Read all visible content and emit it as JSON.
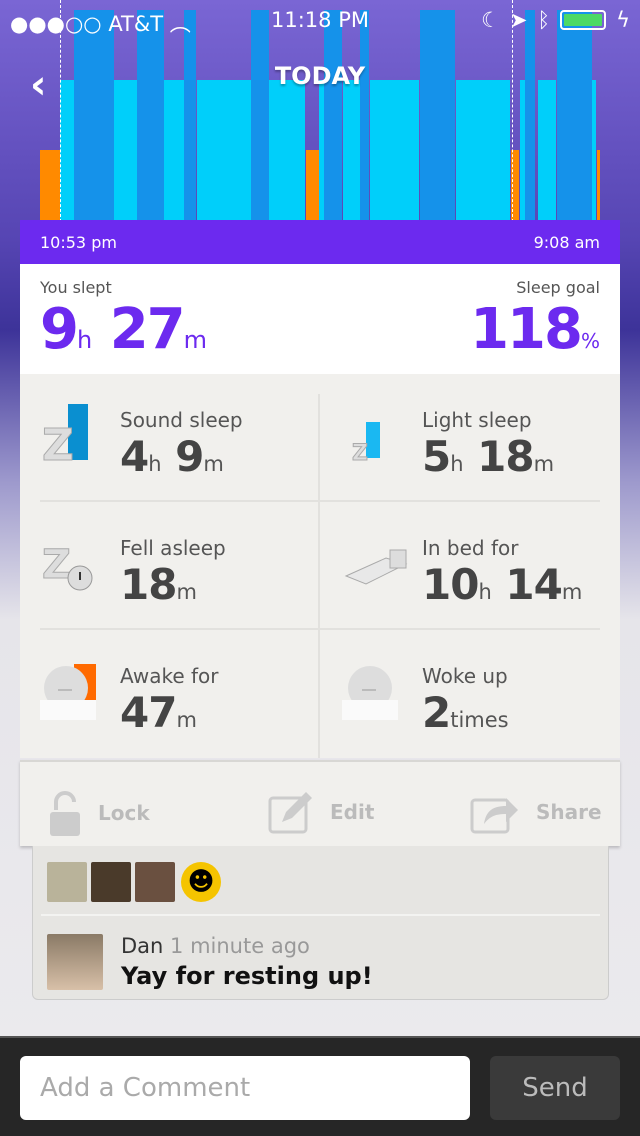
{
  "status_bar": {
    "carrier": "AT&T",
    "time": "11:18 PM",
    "signal_bars": 3,
    "signal_total": 5,
    "icons": [
      "wifi-icon",
      "moon-icon",
      "location-icon",
      "bluetooth-icon",
      "battery-icon",
      "charging-icon"
    ]
  },
  "header": {
    "title": "TODAY",
    "back_icon": "chevron-left-icon"
  },
  "timeline": {
    "start": "10:53 pm",
    "end": "9:08 am"
  },
  "colors": {
    "accent": "#6c2aef",
    "sound_sleep": "#1592ea",
    "light_sleep": "#00cffa",
    "awake": "#ff8a00"
  },
  "summary": {
    "slept_label": "You slept",
    "hours": "9",
    "h": "h",
    "minutes": "27",
    "m": "m",
    "goal_label": "Sleep goal",
    "goal_value": "118",
    "goal_unit": "%"
  },
  "stats": [
    {
      "label": "Sound sleep",
      "parts": [
        [
          "4",
          "h"
        ],
        [
          "9",
          "m"
        ]
      ],
      "icon": "sound-sleep-icon"
    },
    {
      "label": "Light sleep",
      "parts": [
        [
          "5",
          "h"
        ],
        [
          "18",
          "m"
        ]
      ],
      "icon": "light-sleep-icon"
    },
    {
      "label": "Fell asleep",
      "parts": [
        [
          "18",
          "m"
        ]
      ],
      "icon": "fell-asleep-timer-icon"
    },
    {
      "label": "In bed for",
      "parts": [
        [
          "10",
          "h"
        ],
        [
          "14",
          "m"
        ]
      ],
      "icon": "bed-icon"
    },
    {
      "label": "Awake for",
      "parts": [
        [
          "47",
          "m"
        ]
      ],
      "icon": "awake-face-icon"
    },
    {
      "label": "Woke up",
      "parts": [
        [
          "2",
          "times"
        ]
      ],
      "icon": "woke-up-face-icon"
    }
  ],
  "actions": {
    "lock": "Lock",
    "edit": "Edit",
    "share": "Share"
  },
  "comment": {
    "name": "Dan",
    "time": "1 minute ago",
    "message": "Yay for resting up!"
  },
  "composer": {
    "placeholder": "Add a Comment",
    "send": "Send"
  }
}
